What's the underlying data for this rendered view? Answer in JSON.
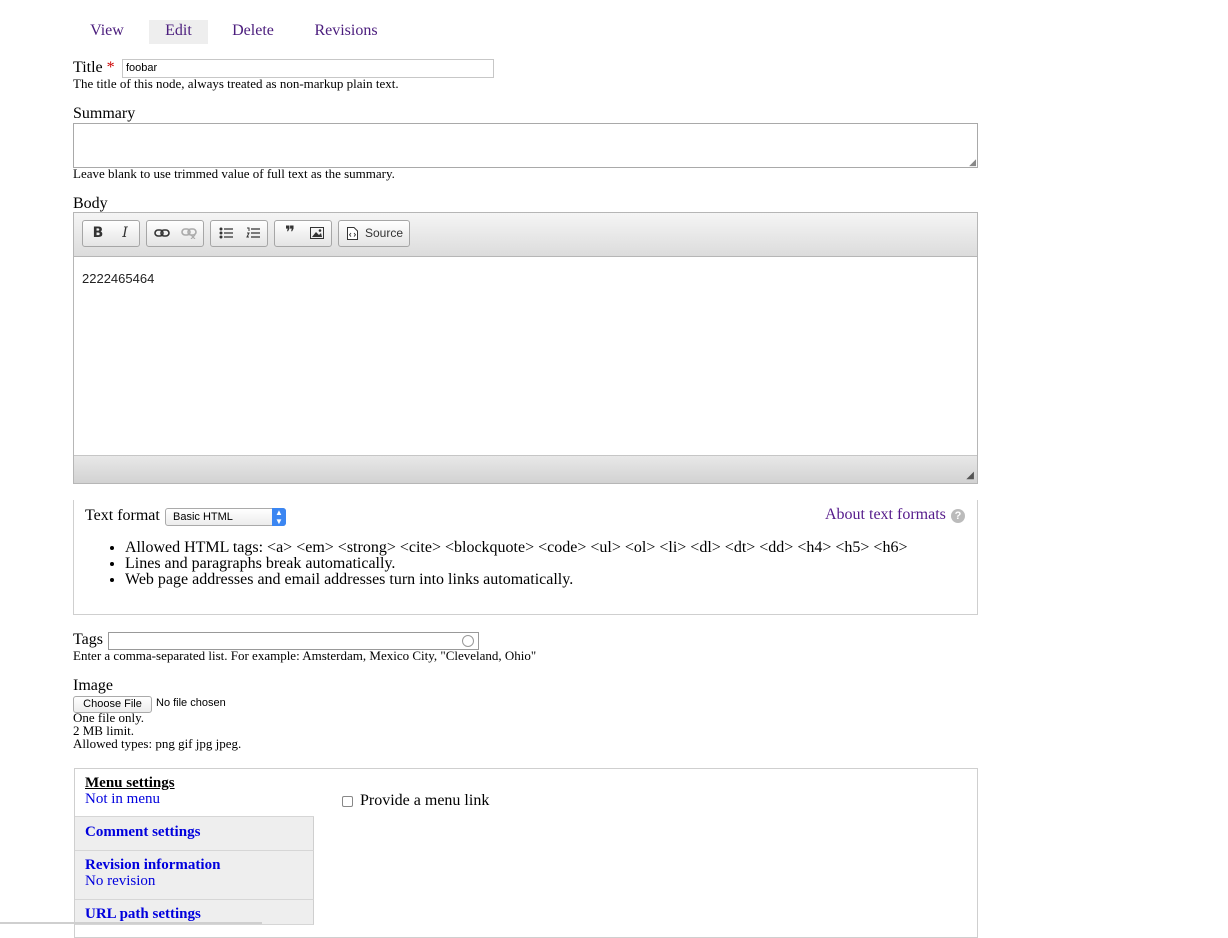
{
  "tabs": [
    {
      "label": "View"
    },
    {
      "label": "Edit"
    },
    {
      "label": "Delete"
    },
    {
      "label": "Revisions"
    }
  ],
  "title_field": {
    "label": "Title",
    "required_marker": "*",
    "value": "foobar",
    "description": "The title of this node, always treated as non-markup plain text."
  },
  "summary_field": {
    "label": "Summary",
    "value": "",
    "description": "Leave blank to use trimmed value of full text as the summary."
  },
  "body_field": {
    "label": "Body",
    "toolbar": {
      "bold": "B",
      "italic": "I",
      "source_label": "Source",
      "icons": [
        "bold-icon",
        "italic-icon",
        "link-icon",
        "unlink-icon",
        "bulleted-list-icon",
        "numbered-list-icon",
        "blockquote-icon",
        "image-icon",
        "source-icon"
      ]
    },
    "content": "2222465464"
  },
  "text_format": {
    "label": "Text format",
    "selected": "Basic HTML",
    "about_link": "About text formats",
    "help_icon": "?",
    "tips": [
      "Allowed HTML tags: <a> <em> <strong> <cite> <blockquote> <code> <ul> <ol> <li> <dl> <dt> <dd> <h4> <h5> <h6>",
      "Lines and paragraphs break automatically.",
      "Web page addresses and email addresses turn into links automatically."
    ]
  },
  "tags_field": {
    "label": "Tags",
    "value": "",
    "description": "Enter a comma-separated list. For example: Amsterdam, Mexico City, \"Cleveland, Ohio\""
  },
  "image_field": {
    "label": "Image",
    "button_label": "Choose File",
    "status": "No file chosen",
    "help": [
      "One file only.",
      "2 MB limit.",
      "Allowed types: png gif jpg jpeg."
    ]
  },
  "vertical_tabs": [
    {
      "title": "Menu settings",
      "summary": "Not in menu"
    },
    {
      "title": "Comment settings",
      "summary": ""
    },
    {
      "title": "Revision information",
      "summary": "No revision"
    },
    {
      "title": "URL path settings",
      "summary": ""
    }
  ],
  "menu_settings_pane": {
    "checkbox_label": "Provide a menu link",
    "checked": false
  }
}
